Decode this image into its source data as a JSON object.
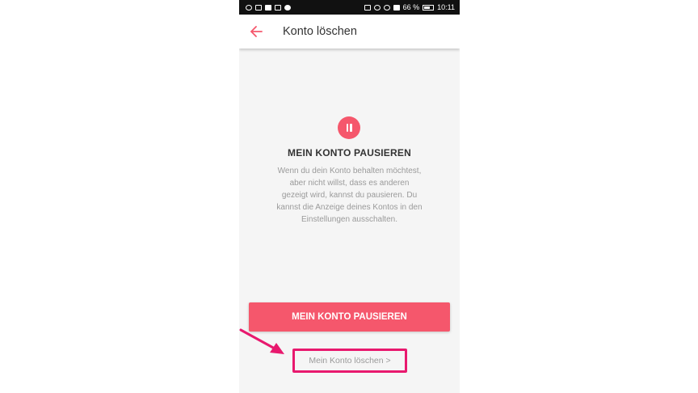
{
  "statusbar": {
    "battery_percent": "66 %",
    "time": "10:11"
  },
  "appbar": {
    "title": "Konto löschen",
    "back_icon": "arrow-left-icon"
  },
  "main": {
    "icon": "pause-icon",
    "heading": "MEIN KONTO PAUSIEREN",
    "description": "Wenn du dein Konto behalten möchtest, aber nicht willst, dass es anderen gezeigt wird, kannst du pausieren. Du kannst die Anzeige deines Kontos in den Einstellungen ausschalten.",
    "pause_button_label": "MEIN KONTO PAUSIEREN",
    "delete_link_label": "Mein Konto löschen >"
  },
  "colors": {
    "accent": "#f5576c",
    "annotation": "#e8196e",
    "statusbar": "#111111",
    "background": "#f5f5f5"
  }
}
